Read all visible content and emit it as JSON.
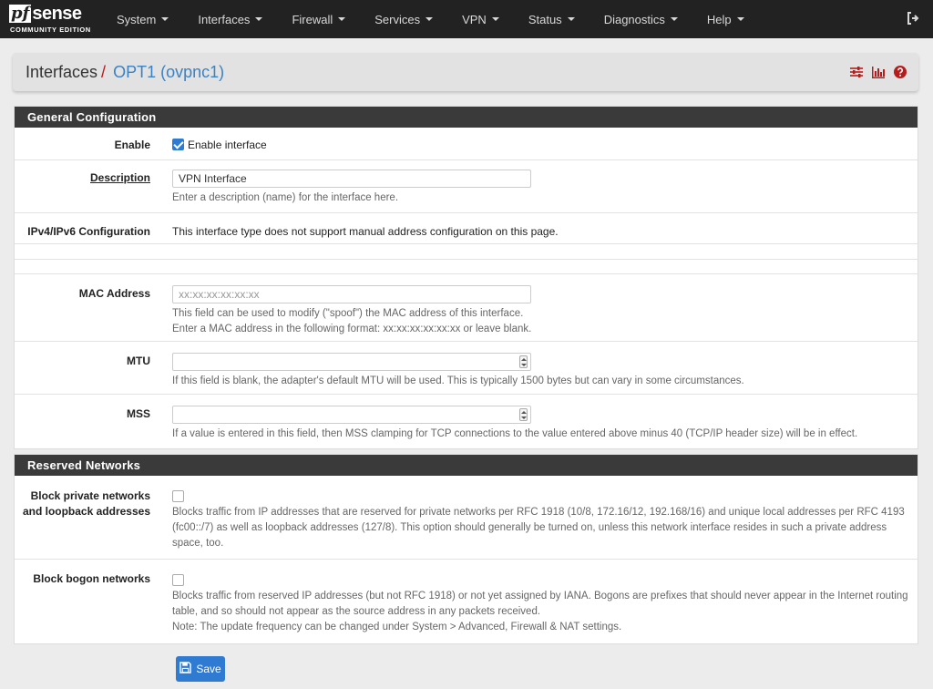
{
  "brand": {
    "logo_pf": "pf",
    "logo_sense": "sense",
    "logo_sub": "COMMUNITY EDITION"
  },
  "nav": {
    "items": [
      {
        "label": "System"
      },
      {
        "label": "Interfaces"
      },
      {
        "label": "Firewall"
      },
      {
        "label": "Services"
      },
      {
        "label": "VPN"
      },
      {
        "label": "Status"
      },
      {
        "label": "Diagnostics"
      },
      {
        "label": "Help"
      }
    ]
  },
  "breadcrumb": {
    "parent": "Interfaces",
    "sep": "/",
    "current": "OPT1 (ovpnc1)"
  },
  "general": {
    "title": "General Configuration",
    "enable_label": "Enable",
    "enable_checkbox_label": "Enable interface",
    "enable_checked": true,
    "description_label": "Description",
    "description_value": "VPN Interface",
    "description_help": "Enter a description (name) for the interface here.",
    "ipv_label": "IPv4/IPv6 Configuration",
    "ipv_text": "This interface type does not support manual address configuration on this page.",
    "mac_label": "MAC Address",
    "mac_placeholder": "xx:xx:xx:xx:xx:xx",
    "mac_help1": "This field can be used to modify (\"spoof\") the MAC address of this interface.",
    "mac_help2": "Enter a MAC address in the following format: xx:xx:xx:xx:xx:xx or leave blank.",
    "mtu_label": "MTU",
    "mtu_help": "If this field is blank, the adapter's default MTU will be used. This is typically 1500 bytes but can vary in some circumstances.",
    "mss_label": "MSS",
    "mss_help": "If a value is entered in this field, then MSS clamping for TCP connections to the value entered above minus 40 (TCP/IP header size) will be in effect."
  },
  "reserved": {
    "title": "Reserved Networks",
    "private_label": "Block private networks and loopback addresses",
    "private_help": "Blocks traffic from IP addresses that are reserved for private networks per RFC 1918 (10/8, 172.16/12, 192.168/16) and unique local addresses per RFC 4193 (fc00::/7) as well as loopback addresses (127/8). This option should generally be turned on, unless this network interface resides in such a private address space, too.",
    "bogon_label": "Block bogon networks",
    "bogon_help1": "Blocks traffic from reserved IP addresses (but not RFC 1918) or not yet assigned by IANA. Bogons are prefixes that should never appear in the Internet routing table, and so should not appear as the source address in any packets received.",
    "bogon_help2": "Note: The update frequency can be changed under System > Advanced, Firewall & NAT settings."
  },
  "save": {
    "label": "Save"
  },
  "colors": {
    "navbar": "#222222",
    "panel_head": "#3a3a3a",
    "accent": "#2f7bd1",
    "crumb_link": "#3a82c4",
    "icon_red": "#b71c1c"
  },
  "icons": [
    "sliders-icon",
    "bar-chart-icon",
    "help-circle-icon",
    "logout-icon",
    "save-icon",
    "caret-down-icon"
  ]
}
